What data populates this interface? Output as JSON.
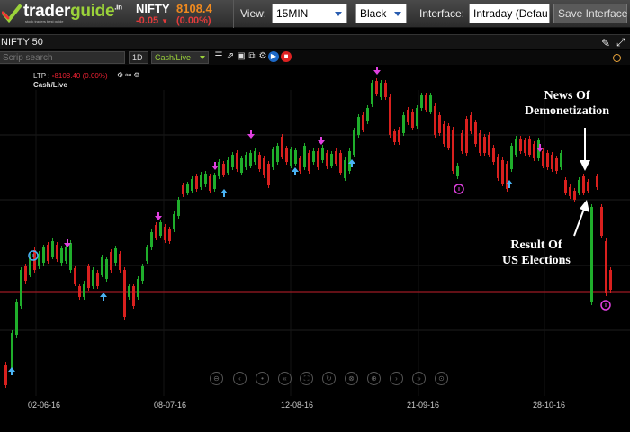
{
  "header": {
    "logo": {
      "trader": "trader",
      "guide": "guide",
      "tld": ".in",
      "tagline": "stock traders best guide"
    },
    "symbol": "NIFTY",
    "price": "8108.4",
    "change": "-0.05",
    "change_pct": "(0.00%)",
    "view_label": "View:",
    "view_value": "15MIN",
    "theme_value": "Black",
    "interface_label": "Interface:",
    "interface_value": "Intraday (Defau",
    "save_button": "Save Interface"
  },
  "subheader": {
    "title": "NIFTY 50"
  },
  "toolbar": {
    "search_placeholder": "Scrip search",
    "timeframe": "1D",
    "feed": "Cash/Live"
  },
  "legend": {
    "ltp_label": "LTP :",
    "ltp_value": "▪8108.40 (0.00%)",
    "feed_label": "Cash/Live"
  },
  "annotations": {
    "demonetization_line1": "News Of",
    "demonetization_line2": "Demonetization",
    "us_line1": "Result  Of",
    "us_line2": "US Elections"
  },
  "chart_data": {
    "type": "candlestick",
    "title": "",
    "x_tick_labels": [
      "02-06-16",
      "08-07-16",
      "12-08-16",
      "21-09-16",
      "28-10-16"
    ],
    "up_color": "#1fae2b",
    "down_color": "#d9201e",
    "horizontal_line_color": "#9c1b23",
    "candles": [
      [
        10,
        5,
        0.34,
        0.47,
        0.34
      ],
      [
        14,
        8,
        0.5,
        0.27,
        0.48
      ],
      [
        19,
        10,
        0.44,
        0.39,
        0.26
      ],
      [
        24,
        7,
        0.22,
        0.18,
        0.14
      ],
      [
        30,
        8,
        0.16,
        0.11,
        0.06
      ],
      [
        36,
        6,
        0.16,
        0.19,
        0.03
      ],
      [
        41,
        7,
        0.25,
        0.24,
        0.15
      ],
      [
        46,
        8,
        0.22,
        0.16,
        0.11
      ],
      [
        52,
        9,
        0.18,
        0.21,
        0.03
      ],
      [
        57,
        8,
        0.14,
        0.17,
        0.05
      ],
      [
        62,
        6,
        0.16,
        0.1,
        0.09
      ],
      [
        67,
        6,
        0.14,
        0.17,
        0.03
      ],
      [
        72,
        7,
        0.17,
        0.11,
        0.07
      ],
      [
        78,
        7,
        0.14,
        0.12,
        0.07
      ],
      [
        82,
        8,
        0.14,
        0.18,
        0.05
      ],
      [
        87,
        5,
        0.29,
        0.22,
        0.07
      ],
      [
        92,
        5,
        0.31,
        0.26,
        0.06
      ],
      [
        97,
        6,
        0.31,
        0.23,
        0.1
      ],
      [
        102,
        6,
        0.27,
        0.16,
        0.08
      ],
      [
        107,
        6,
        0.3,
        0.22,
        0.08
      ],
      [
        112,
        6,
        0.25,
        0.17,
        0.09
      ],
      [
        117,
        5,
        0.22,
        0.15,
        0.09
      ],
      [
        122,
        8,
        0.17,
        0.1,
        0.08
      ],
      [
        127,
        8,
        0.13,
        0.12,
        0.05
      ],
      [
        132,
        6,
        0.19,
        0.13,
        0.1
      ],
      [
        137,
        6,
        0.18,
        0.24,
        0.05
      ],
      [
        142,
        7,
        0.27,
        0.18,
        0.1
      ],
      [
        147,
        7,
        0.21,
        0.27,
        0.03
      ],
      [
        152,
        6,
        0.18,
        0.27,
        0.04
      ],
      [
        157,
        6,
        0.14,
        0.17,
        0.03
      ],
      [
        162,
        7,
        0.07,
        0.03,
        0.06
      ],
      [
        167,
        6,
        0.06,
        0.09,
        0.01
      ],
      [
        172,
        6,
        0.04,
        0.02,
        0.04
      ],
      [
        177,
        6,
        0.01,
        0.05,
        0.01
      ],
      [
        182,
        6,
        0.02,
        0.02,
        0.05
      ],
      [
        187,
        6,
        0.04,
        0.08,
        0.01
      ],
      [
        192,
        6,
        0.09,
        0.11,
        0.02
      ],
      [
        197,
        5,
        0.15,
        0.17,
        0.01
      ],
      [
        202,
        6,
        0.2,
        0.11,
        0.1
      ],
      [
        207,
        6,
        0.19,
        0.17,
        0.04
      ],
      [
        212,
        6,
        0.22,
        0.24,
        0.03
      ],
      [
        217,
        5,
        0.27,
        0.25,
        0.06
      ],
      [
        222,
        6,
        0.27,
        0.24,
        0.06
      ],
      [
        227,
        6,
        0.27,
        0.28,
        0.03
      ],
      [
        232,
        6,
        0.29,
        0.25,
        0.06
      ],
      [
        237,
        6,
        0.31,
        0.33,
        0.03
      ],
      [
        242,
        6,
        0.34,
        0.27,
        0.08
      ],
      [
        247,
        6,
        0.32,
        0.35,
        0.02
      ],
      [
        252,
        6,
        0.38,
        0.36,
        0.04
      ],
      [
        257,
        6,
        0.38,
        0.41,
        0.02
      ],
      [
        262,
        6,
        0.43,
        0.36,
        0.08
      ],
      [
        267,
        6,
        0.4,
        0.44,
        0.02
      ],
      [
        272,
        7,
        0.44,
        0.41,
        0.05
      ],
      [
        277,
        7,
        0.45,
        0.46,
        0.02
      ],
      [
        282,
        7,
        0.46,
        0.44,
        0.04
      ],
      [
        287,
        6,
        0.45,
        0.48,
        0.02
      ],
      [
        292,
        7,
        0.49,
        0.46,
        0.05
      ],
      [
        297,
        6,
        0.48,
        0.52,
        0.02
      ],
      [
        302,
        6,
        0.53,
        0.56,
        0.01
      ],
      [
        307,
        7,
        0.55,
        0.53,
        0.04
      ],
      [
        312,
        6,
        0.58,
        0.57,
        0.05
      ],
      [
        317,
        7,
        0.61,
        0.6,
        0.03
      ],
      [
        322,
        7,
        0.64,
        0.66,
        0.02
      ],
      [
        327,
        6,
        0.66,
        0.64,
        0.05
      ],
      [
        332,
        7,
        0.65,
        0.68,
        0.02
      ],
      [
        337,
        7,
        0.67,
        0.65,
        0.04
      ],
      [
        342,
        6,
        0.66,
        0.69,
        0.02
      ],
      [
        347,
        6,
        0.68,
        0.66,
        0.04
      ],
      [
        352,
        6,
        0.7,
        0.74,
        0.02
      ],
      [
        357,
        7,
        0.73,
        0.72,
        0.04
      ],
      [
        362,
        6,
        0.75,
        0.8,
        0.02
      ],
      [
        367,
        7,
        0.78,
        0.77,
        0.04
      ],
      [
        372,
        6,
        0.81,
        0.86,
        0.02
      ],
      [
        377,
        6,
        0.84,
        0.82,
        0.04
      ],
      [
        382,
        6,
        0.87,
        0.91,
        0.03
      ],
      [
        387,
        7,
        0.9,
        0.88,
        0.04
      ],
      [
        392,
        7,
        0.92,
        0.98,
        0.03
      ],
      [
        397,
        7,
        0.97,
        0.95,
        0.05
      ],
      [
        402,
        6,
        0.99,
        1.02,
        0.03
      ],
      [
        407,
        7,
        1.02,
        1.04,
        0.02
      ]
    ]
  }
}
